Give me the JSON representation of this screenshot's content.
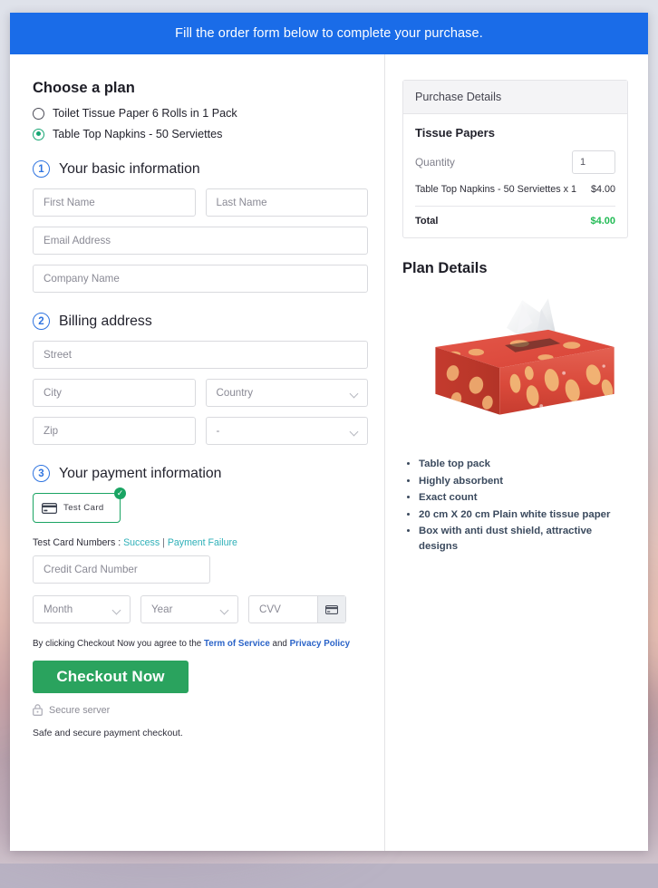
{
  "banner": {
    "text": "Fill the order form below to complete your purchase."
  },
  "plan": {
    "heading": "Choose a plan",
    "options": [
      {
        "label": "Toilet Tissue Paper 6 Rolls in 1 Pack",
        "selected": false
      },
      {
        "label": "Table Top Napkins - 50 Serviettes",
        "selected": true
      }
    ]
  },
  "step1": {
    "number": "1",
    "title": "Your basic information",
    "first_name_placeholder": "First Name",
    "last_name_placeholder": "Last Name",
    "email_placeholder": "Email Address",
    "company_placeholder": "Company Name"
  },
  "step2": {
    "number": "2",
    "title": "Billing address",
    "street_placeholder": "Street",
    "city_placeholder": "City",
    "country_placeholder": "Country",
    "zip_placeholder": "Zip",
    "state_placeholder": "-"
  },
  "step3": {
    "number": "3",
    "title": "Your payment information",
    "test_card_label": "Test Card",
    "test_numbers_label": "Test Card Numbers :",
    "success_link": "Success",
    "separator": "|",
    "failure_link": "Payment Failure",
    "card_number_placeholder": "Credit Card Number",
    "month_placeholder": "Month",
    "year_placeholder": "Year",
    "cvv_placeholder": "CVV"
  },
  "footer": {
    "terms_prefix": "By clicking Checkout Now you agree to the",
    "terms_link": "Term of Service",
    "terms_and": "and",
    "privacy_link": "Privacy Policy",
    "checkout_label": "Checkout Now",
    "secure_label": "Secure server",
    "safe_label": "Safe and secure payment checkout."
  },
  "purchase": {
    "header": "Purchase Details",
    "product": "Tissue Papers",
    "quantity_label": "Quantity",
    "quantity_value": "1",
    "line_item": "Table Top Napkins - 50 Serviettes x 1",
    "line_amount": "$4.00",
    "total_label": "Total",
    "total_amount": "$4.00"
  },
  "plan_details": {
    "heading": "Plan Details",
    "features": [
      "Table top pack",
      "Highly absorbent",
      "Exact count",
      "20 cm X 20 cm Plain white tissue paper",
      "Box with anti dust shield, attractive designs"
    ]
  },
  "colors": {
    "banner_blue": "#1a6ce8",
    "step_blue": "#2f74e0",
    "selected_green": "#17a673",
    "checkout_green": "#2aa35e",
    "total_green": "#22bb55",
    "link_teal": "#2fb0b8",
    "link_blue": "#2a63c8"
  }
}
